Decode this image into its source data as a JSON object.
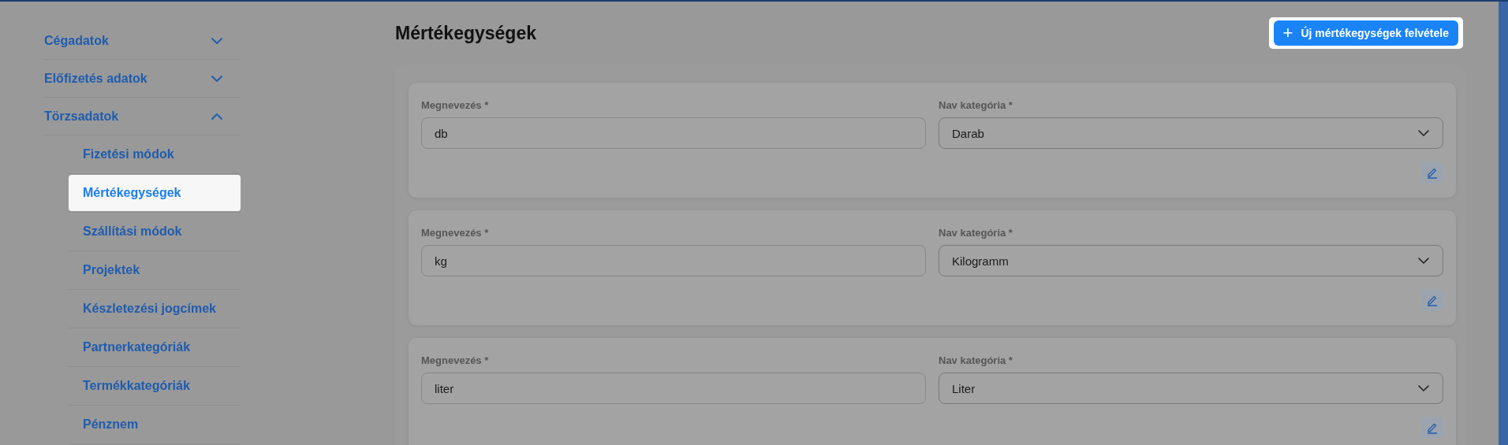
{
  "sidebar": {
    "sections": [
      {
        "label": "Cégadatok",
        "expanded": false
      },
      {
        "label": "Előfizetés adatok",
        "expanded": false
      },
      {
        "label": "Törzsadatok",
        "expanded": true,
        "children": [
          {
            "label": "Fizetési módok",
            "selected": false
          },
          {
            "label": "Mértékegységek",
            "selected": true
          },
          {
            "label": "Szállítási módok",
            "selected": false
          },
          {
            "label": "Projektek",
            "selected": false
          },
          {
            "label": "Készletezési jogcímek",
            "selected": false
          },
          {
            "label": "Partnerkategóriák",
            "selected": false
          },
          {
            "label": "Termékkategóriák",
            "selected": false
          },
          {
            "label": "Pénznem",
            "selected": false
          }
        ]
      }
    ]
  },
  "page_title": "Mértékegységek",
  "add_button": {
    "icon": "+",
    "label": "Új mértékegységek felvétele"
  },
  "units": [
    {
      "name_label": "Megnevezés *",
      "name_value": "db",
      "category_label": "Nav kategória *",
      "category_value": "Darab"
    },
    {
      "name_label": "Megnevezés *",
      "name_value": "kg",
      "category_label": "Nav kategória *",
      "category_value": "Kilogramm"
    },
    {
      "name_label": "Megnevezés *",
      "name_value": "liter",
      "category_label": "Nav kategória *",
      "category_value": "Liter"
    }
  ]
}
